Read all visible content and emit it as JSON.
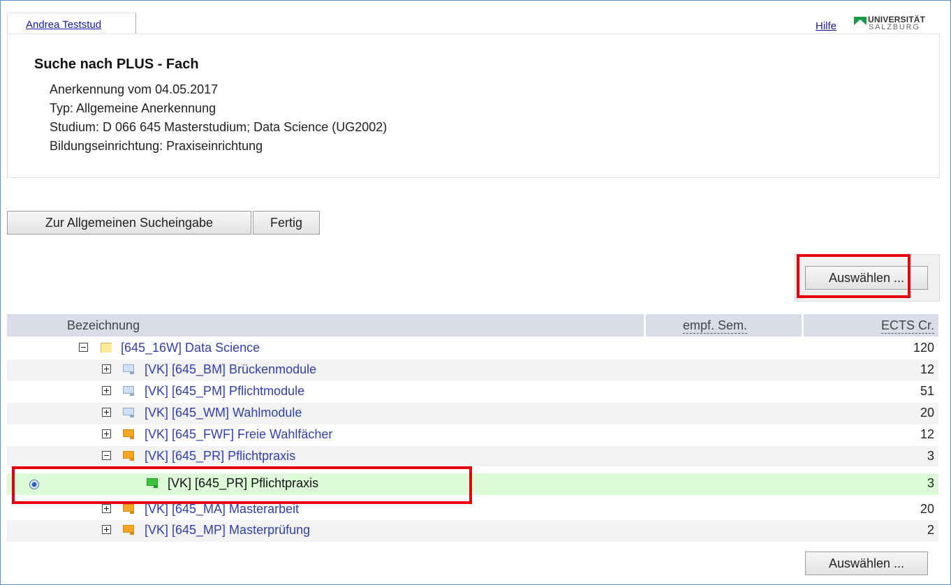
{
  "header": {
    "user_name": "Andrea Teststud",
    "help_label": "Hilfe",
    "logo_line1": "UNIVERSITÄT",
    "logo_line2": "SALZBURG"
  },
  "info": {
    "title": "Suche nach PLUS - Fach",
    "lines": [
      "Anerkennung vom 04.05.2017",
      "Typ: Allgemeine Anerkennung",
      "Studium: D 066 645 Masterstudium; Data Science (UG2002)",
      "Bildungseinrichtung: Praxiseinrichtung"
    ]
  },
  "buttons": {
    "general_search": "Zur Allgemeinen Sucheingabe",
    "done": "Fertig",
    "select_top": "Auswählen ...",
    "select_bottom": "Auswählen ..."
  },
  "table": {
    "columns": [
      "Bezeichnung",
      "empf. Sem.",
      "ECTS Cr."
    ],
    "rows": [
      {
        "label": "[645_16W] Data Science",
        "ects": "120",
        "toggle": "minus",
        "icon": "folder-icon",
        "level": 0
      },
      {
        "label": "[VK] [645_BM] Brückenmodule",
        "ects": "12",
        "toggle": "plus",
        "icon": "module-blue-icon",
        "level": 1
      },
      {
        "label": "[VK] [645_PM] Pflichtmodule",
        "ects": "51",
        "toggle": "plus",
        "icon": "module-blue-icon",
        "level": 1
      },
      {
        "label": "[VK] [645_WM] Wahlmodule",
        "ects": "20",
        "toggle": "plus",
        "icon": "module-blue-icon",
        "level": 1
      },
      {
        "label": "[VK] [645_FWF] Freie Wahlfächer",
        "ects": "12",
        "toggle": "plus",
        "icon": "module-orange-icon",
        "level": 1
      },
      {
        "label": "[VK] [645_PR] Pflichtpraxis",
        "ects": "3",
        "toggle": "minus",
        "icon": "module-orange-icon",
        "level": 1
      },
      {
        "label": "[VK] [645_PR] Pflichtpraxis",
        "ects": "3",
        "toggle": "none",
        "icon": "module-green-icon",
        "level": 2,
        "selected": true
      },
      {
        "label": "[VK] [645_MA] Masterarbeit",
        "ects": "20",
        "toggle": "plus",
        "icon": "module-orange-icon",
        "level": 1
      },
      {
        "label": "[VK] [645_MP] Masterprüfung",
        "ects": "2",
        "toggle": "plus",
        "icon": "module-orange-icon",
        "level": 1
      }
    ]
  },
  "colors": {
    "highlight": "#e8000c",
    "link": "#2f3fb0",
    "selected_row": "#dcfad8",
    "header_bg": "#d9dde8"
  }
}
